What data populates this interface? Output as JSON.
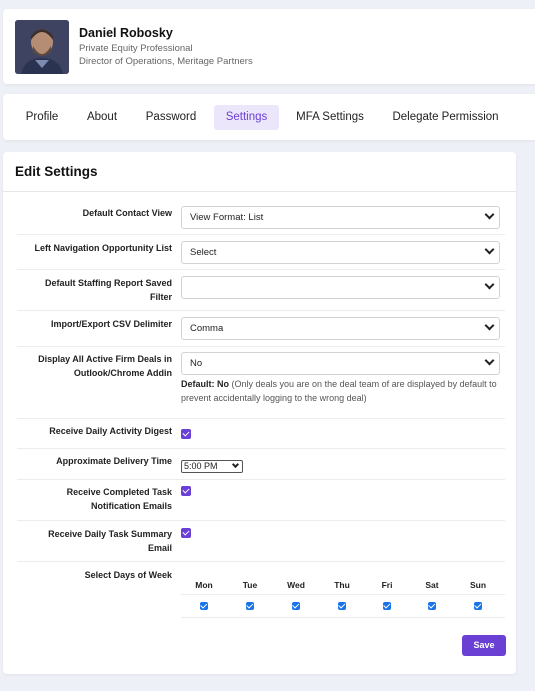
{
  "profile": {
    "name": "Daniel Robosky",
    "role": "Private Equity Professional",
    "title": "Director of Operations, Meritage Partners"
  },
  "tabs": [
    {
      "label": "Profile",
      "active": false
    },
    {
      "label": "About",
      "active": false
    },
    {
      "label": "Password",
      "active": false
    },
    {
      "label": "Settings",
      "active": true
    },
    {
      "label": "MFA Settings",
      "active": false
    },
    {
      "label": "Delegate Permission",
      "active": false
    }
  ],
  "settings": {
    "title": "Edit Settings",
    "default_contact_view": {
      "label": "Default Contact View",
      "value": "View Format: List"
    },
    "left_nav_opportunity": {
      "label": "Left Navigation Opportunity List",
      "value": "Select"
    },
    "default_staffing_filter": {
      "label": "Default Staffing Report Saved Filter",
      "value": ""
    },
    "csv_delimiter": {
      "label": "Import/Export CSV Delimiter",
      "value": "Comma"
    },
    "display_active_deals": {
      "label": "Display All Active Firm Deals in Outlook/Chrome Addin",
      "value": "No",
      "hint_default": "Default: No",
      "hint_text": "(Only deals you are on the deal team of are displayed by default to prevent accidentally logging to the wrong deal)"
    },
    "daily_activity_digest": {
      "label": "Receive Daily Activity Digest",
      "checked": true
    },
    "delivery_time": {
      "label": "Approximate Delivery Time",
      "value": "5:00 PM"
    },
    "completed_task_emails": {
      "label": "Receive Completed Task Notification Emails",
      "checked": true
    },
    "daily_task_summary": {
      "label": "Receive Daily Task Summary Email",
      "checked": true
    },
    "days_of_week": {
      "label": "Select Days of Week",
      "days": [
        "Mon",
        "Tue",
        "Wed",
        "Thu",
        "Fri",
        "Sat",
        "Sun"
      ],
      "checked": [
        true,
        true,
        true,
        true,
        true,
        true,
        true
      ]
    },
    "save_label": "Save"
  },
  "colors": {
    "accent": "#6a3fd4",
    "tab_active_bg": "#ece6fb",
    "page_bg": "#eef0f7"
  }
}
